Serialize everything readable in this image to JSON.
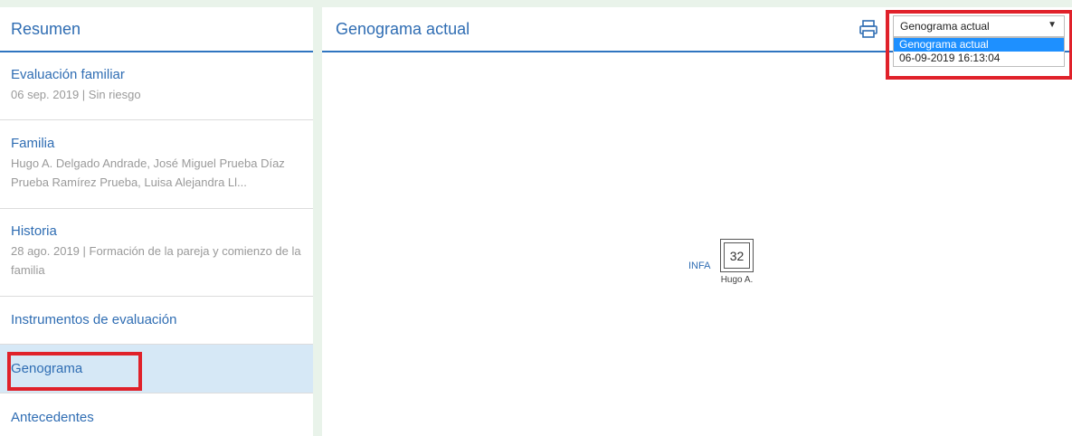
{
  "sidebar": {
    "header": "Resumen",
    "items": [
      {
        "title": "Evaluación familiar",
        "subtitle": "06 sep. 2019 | Sin riesgo"
      },
      {
        "title": "Familia",
        "subtitle": "Hugo A. Delgado Andrade, José Miguel Prueba Díaz Prueba Ramírez Prueba, Luisa Alejandra Ll..."
      },
      {
        "title": "Historia",
        "subtitle": "28 ago. 2019 | Formación de la pareja y comienzo de la familia"
      },
      {
        "title": "Instrumentos de evaluación"
      },
      {
        "title": "Genograma",
        "selected": true
      },
      {
        "title": "Antecedentes"
      }
    ]
  },
  "main": {
    "title": "Genograma actual",
    "print_icon": "printer-icon",
    "select": {
      "value": "Genograma actual",
      "options": [
        "Genograma actual",
        "06-09-2019 16:13:04"
      ],
      "selected_index": 0
    },
    "genogram": {
      "label": "INFA",
      "age": "32",
      "name": "Hugo A."
    }
  },
  "colors": {
    "accent": "#2f6db3",
    "selected_bg": "#d6e8f6",
    "highlight": "#e0212a",
    "option_selected": "#1e90ff"
  }
}
